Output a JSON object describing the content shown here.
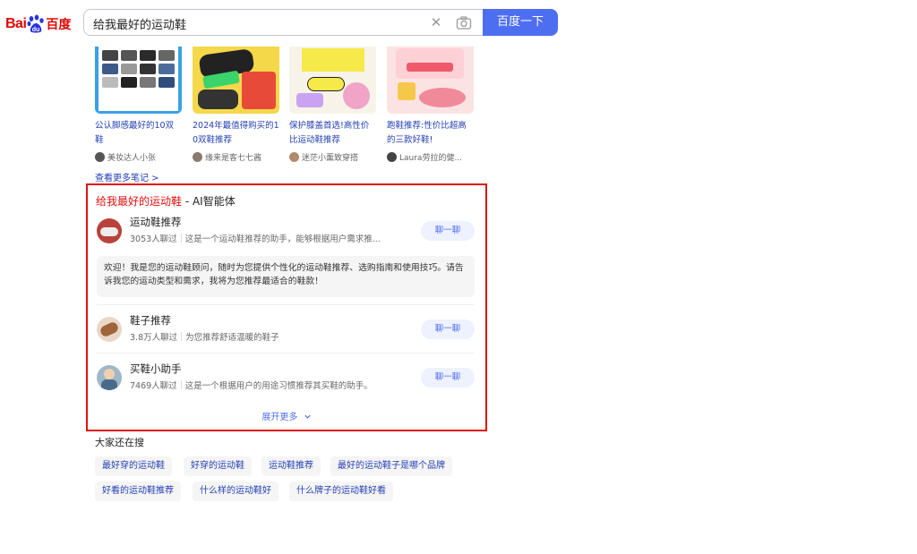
{
  "header": {
    "logo_bai": "Bai",
    "logo_du": "百度",
    "query": "给我最好的运动鞋",
    "search_button": "百度一下"
  },
  "notes": [
    {
      "title": "公认脚感最好的10双鞋",
      "author": "美妆达人小张"
    },
    {
      "title": "2024年最值得购买的10双鞋推荐",
      "author": "缘来是客七七酱"
    },
    {
      "title": "保护膝盖首选!高性价比运动鞋推荐",
      "author": "迷茫小薰致穿搭"
    },
    {
      "title": "跑鞋推荐:性价比超高的三款好鞋!",
      "author": "Laura劳拉的健..."
    }
  ],
  "more_notes": "查看更多笔记 >",
  "ai": {
    "title_query": "给我最好的运动鞋",
    "title_suffix": " - AI智能体",
    "agents": [
      {
        "name": "运动鞋推荐",
        "count": "3053人聊过",
        "desc": "这是一个运动鞋推荐的助手，能够根据用户需求推...",
        "chat": "聊一聊"
      },
      {
        "name": "鞋子推荐",
        "count": "3.8万人聊过",
        "desc": "为您推荐舒适温暖的鞋子",
        "chat": "聊一聊"
      },
      {
        "name": "买鞋小助手",
        "count": "7469人聊过",
        "desc": "这是一个根据用户的用途习惯推荐其买鞋的助手。",
        "chat": "聊一聊"
      }
    ],
    "welcome": "欢迎！我是您的运动鞋顾问，随时为您提供个性化的运动鞋推荐、选购指南和使用技巧。请告诉我您的运动类型和需求，我将为您推荐最适合的鞋款！",
    "expand": "展开更多"
  },
  "related": {
    "title": "大家还在搜",
    "tags": [
      "最好穿的运动鞋",
      "好穿的运动鞋",
      "运动鞋推荐",
      "最好的运动鞋子是哪个品牌",
      "好看的运动鞋推荐",
      "什么样的运动鞋好",
      "什么牌子的运动鞋好看"
    ]
  },
  "colors": {
    "brand_red": "#e10602",
    "brand_blue": "#4e6ef2",
    "link_blue": "#2440b3",
    "highlight_border": "#e0120f"
  },
  "icons": [
    "baidu-paw-icon",
    "clear-icon",
    "camera-icon",
    "chevron-down-icon"
  ]
}
